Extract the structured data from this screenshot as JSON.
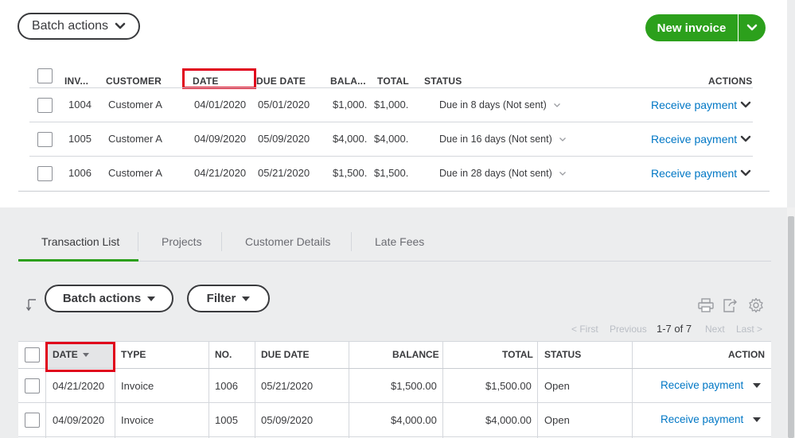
{
  "top": {
    "batch_actions": "Batch actions",
    "new_invoice": "New invoice",
    "headers": {
      "inv": "INV...",
      "customer": "CUSTOMER",
      "date": "DATE",
      "due_date": "DUE DATE",
      "balance": "BALA...",
      "total": "TOTAL",
      "status": "STATUS",
      "actions": "ACTIONS"
    },
    "rows": [
      {
        "inv": "1004",
        "customer": "Customer A",
        "date": "04/01/2020",
        "due": "05/01/2020",
        "balance": "$1,000.",
        "total": "$1,000.",
        "status": "Due in 8 days (Not sent)",
        "action": "Receive payment"
      },
      {
        "inv": "1005",
        "customer": "Customer A",
        "date": "04/09/2020",
        "due": "05/09/2020",
        "balance": "$4,000.",
        "total": "$4,000.",
        "status": "Due in 16 days (Not sent)",
        "action": "Receive payment"
      },
      {
        "inv": "1006",
        "customer": "Customer A",
        "date": "04/21/2020",
        "due": "05/21/2020",
        "balance": "$1,500.",
        "total": "$1,500.",
        "status": "Due in 28 days (Not sent)",
        "action": "Receive payment"
      }
    ]
  },
  "tabs": {
    "transaction_list": "Transaction List",
    "projects": "Projects",
    "customer_details": "Customer Details",
    "late_fees": "Late Fees"
  },
  "lower": {
    "batch_actions": "Batch actions",
    "filter": "Filter",
    "pager": {
      "first": "< First",
      "previous": "Previous",
      "count": "1-7 of 7",
      "next": "Next",
      "last": "Last >"
    },
    "headers": {
      "date": "DATE",
      "type": "TYPE",
      "no": "NO.",
      "due_date": "DUE DATE",
      "balance": "BALANCE",
      "total": "TOTAL",
      "status": "STATUS",
      "action": "ACTION"
    },
    "rows": [
      {
        "date": "04/21/2020",
        "type": "Invoice",
        "no": "1006",
        "due": "05/21/2020",
        "balance": "$1,500.00",
        "total": "$1,500.00",
        "status": "Open",
        "action": "Receive payment"
      },
      {
        "date": "04/09/2020",
        "type": "Invoice",
        "no": "1005",
        "due": "05/09/2020",
        "balance": "$4,000.00",
        "total": "$4,000.00",
        "status": "Open",
        "action": "Receive payment"
      }
    ]
  },
  "colors": {
    "brand_green": "#2ca01c",
    "link_blue": "#0077c5",
    "highlight_red": "#e0001b"
  }
}
